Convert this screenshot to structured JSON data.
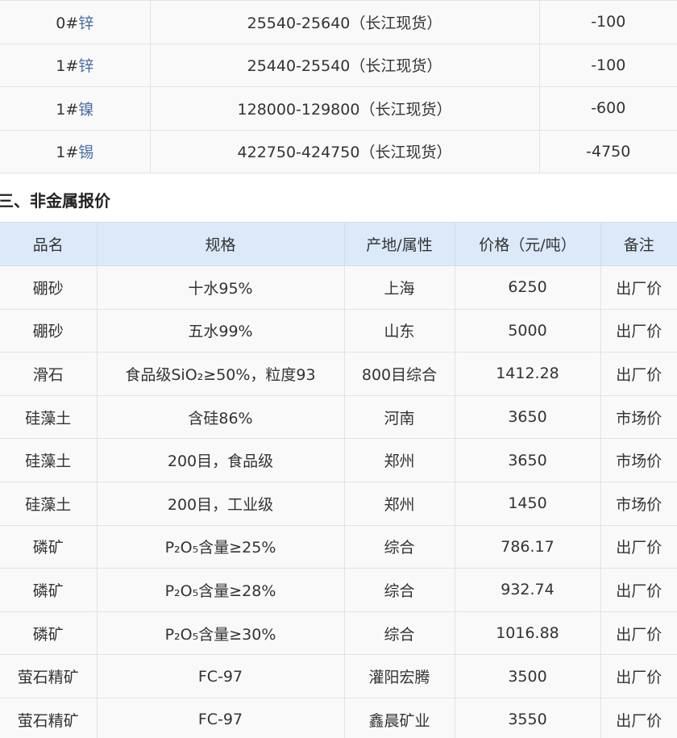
{
  "metal_rows": [
    {
      "grade": "0#",
      "metal": "锌",
      "price": "25540-25640（长江现货）",
      "change": "-100"
    },
    {
      "grade": "1#",
      "metal": "锌",
      "price": "25440-25540（长江现货）",
      "change": "-100"
    },
    {
      "grade": "1#",
      "metal": "镍",
      "price": "128000-129800（长江现货）",
      "change": "-600"
    },
    {
      "grade": "1#",
      "metal": "锡",
      "price": "422750-424750（长江现货）",
      "change": "-4750"
    }
  ],
  "section_title": "三、非金属报价",
  "nonmetal_headers": [
    "品名",
    "规格",
    "产地/属性",
    "价格（元/吨）",
    "备注"
  ],
  "nonmetal_rows": [
    {
      "name": "硼砂",
      "spec": "十水95%",
      "origin": "上海",
      "price": "6250",
      "note": "出厂价"
    },
    {
      "name": "硼砂",
      "spec": "五水99%",
      "origin": "山东",
      "price": "5000",
      "note": "出厂价"
    },
    {
      "name": "滑石",
      "spec": "食品级SiO₂≥50%，粒度93",
      "origin": "800目综合",
      "price": "1412.28",
      "note": "出厂价"
    },
    {
      "name": "硅藻土",
      "spec": "含硅86%",
      "origin": "河南",
      "price": "3650",
      "note": "市场价"
    },
    {
      "name": "硅藻土",
      "spec": "200目，食品级",
      "origin": "郑州",
      "price": "3650",
      "note": "市场价"
    },
    {
      "name": "硅藻土",
      "spec": "200目，工业级",
      "origin": "郑州",
      "price": "1450",
      "note": "市场价"
    },
    {
      "name": "磷矿",
      "spec": "P₂O₅含量≥25%",
      "origin": "综合",
      "price": "786.17",
      "note": "出厂价"
    },
    {
      "name": "磷矿",
      "spec": "P₂O₅含量≥28%",
      "origin": "综合",
      "price": "932.74",
      "note": "出厂价"
    },
    {
      "name": "磷矿",
      "spec": "P₂O₅含量≥30%",
      "origin": "综合",
      "price": "1016.88",
      "note": "出厂价"
    },
    {
      "name": "萤石精矿",
      "spec": "FC-97",
      "origin": "灌阳宏腾",
      "price": "3500",
      "note": "出厂价"
    },
    {
      "name": "萤石精矿",
      "spec": "FC-97",
      "origin": "鑫晨矿业",
      "price": "3550",
      "note": "出厂价"
    }
  ]
}
